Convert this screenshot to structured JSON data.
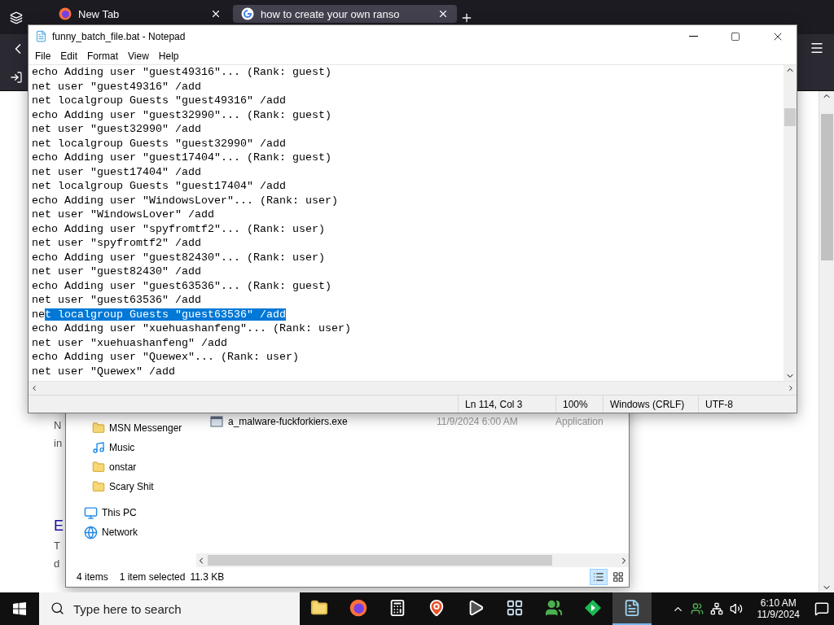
{
  "browser": {
    "tabs": [
      {
        "title": "New Tab",
        "selected": false
      },
      {
        "title": "how to create your own ranso",
        "selected": true
      }
    ],
    "page_fragments": [
      {
        "text": "N",
        "kind": "plain"
      },
      {
        "text": "in",
        "kind": "plain"
      },
      {
        "text": "E",
        "kind": "heading"
      },
      {
        "text": "T",
        "kind": "plain"
      },
      {
        "text": "d",
        "kind": "plain"
      }
    ]
  },
  "notepad": {
    "title": "funny_batch_file.bat - Notepad",
    "menu": [
      "File",
      "Edit",
      "Format",
      "View",
      "Help"
    ],
    "lines": [
      {
        "segments": [
          {
            "text": "echo Adding user \"guest49316\"... (Rank: guest)",
            "selected": false
          }
        ]
      },
      {
        "segments": [
          {
            "text": "net user \"guest49316\" /add",
            "selected": false
          }
        ]
      },
      {
        "segments": [
          {
            "text": "net localgroup Guests \"guest49316\" /add",
            "selected": false
          }
        ]
      },
      {
        "segments": [
          {
            "text": "echo Adding user \"guest32990\"... (Rank: guest)",
            "selected": false
          }
        ]
      },
      {
        "segments": [
          {
            "text": "net user \"guest32990\" /add",
            "selected": false
          }
        ]
      },
      {
        "segments": [
          {
            "text": "net localgroup Guests \"guest32990\" /add",
            "selected": false
          }
        ]
      },
      {
        "segments": [
          {
            "text": "echo Adding user \"guest17404\"... (Rank: guest)",
            "selected": false
          }
        ]
      },
      {
        "segments": [
          {
            "text": "net user \"guest17404\" /add",
            "selected": false
          }
        ]
      },
      {
        "segments": [
          {
            "text": "net localgroup Guests \"guest17404\" /add",
            "selected": false
          }
        ]
      },
      {
        "segments": [
          {
            "text": "echo Adding user \"WindowsLover\"... (Rank: user)",
            "selected": false
          }
        ]
      },
      {
        "segments": [
          {
            "text": "net user \"WindowsLover\" /add",
            "selected": false
          }
        ]
      },
      {
        "segments": [
          {
            "text": "echo Adding user \"spyfromtf2\"... (Rank: user)",
            "selected": false
          }
        ]
      },
      {
        "segments": [
          {
            "text": "net user \"spyfromtf2\" /add",
            "selected": false
          }
        ]
      },
      {
        "segments": [
          {
            "text": "echo Adding user \"guest82430\"... (Rank: user)",
            "selected": false
          }
        ]
      },
      {
        "segments": [
          {
            "text": "net user \"guest82430\" /add",
            "selected": false
          }
        ]
      },
      {
        "segments": [
          {
            "text": "echo Adding user \"guest63536\"... (Rank: guest)",
            "selected": false
          }
        ]
      },
      {
        "segments": [
          {
            "text": "net user \"guest63536\" /add",
            "selected": false
          }
        ]
      },
      {
        "segments": [
          {
            "text": "ne",
            "selected": false
          },
          {
            "text": "t localgroup Guests \"guest63536\" /add",
            "selected": true
          }
        ]
      },
      {
        "segments": [
          {
            "text": "echo Adding user \"xuehuashanfeng\"... (Rank: user)",
            "selected": false
          }
        ]
      },
      {
        "segments": [
          {
            "text": "net user \"xuehuashanfeng\" /add",
            "selected": false
          }
        ]
      },
      {
        "segments": [
          {
            "text": "echo Adding user \"Quewex\"... (Rank: user)",
            "selected": false
          }
        ]
      },
      {
        "segments": [
          {
            "text": "net user \"Quewex\" /add",
            "selected": false
          }
        ]
      }
    ],
    "status": [
      "Ln 114, Col 3",
      "100%",
      "Windows (CRLF)",
      "UTF-8"
    ]
  },
  "explorer": {
    "subfolders": [
      {
        "label": "MSN Messenger",
        "kind": "folder"
      },
      {
        "label": "Music",
        "kind": "music"
      },
      {
        "label": "onstar",
        "kind": "folder"
      },
      {
        "label": "Scary Shit",
        "kind": "folder"
      }
    ],
    "locations": [
      {
        "label": "This PC",
        "kind": "pc"
      },
      {
        "label": "Network",
        "kind": "network"
      }
    ],
    "files": [
      {
        "name": "a_malware-fuckforkiers.exe",
        "date": "11/9/2024 6:00 AM",
        "type": "Application"
      }
    ],
    "status": {
      "count": "4 items",
      "selection": "1 item selected",
      "size": "11.3 KB"
    },
    "views": [
      {
        "kind": "details",
        "selected": true
      },
      {
        "kind": "tiles",
        "selected": false
      }
    ]
  },
  "taskbar": {
    "search": {
      "placeholder": "Type here to search"
    },
    "apps": [
      {
        "kind": "explorer",
        "selected": false
      },
      {
        "kind": "firefox",
        "selected": false
      },
      {
        "kind": "calculator",
        "selected": false
      },
      {
        "kind": "maps",
        "selected": false
      },
      {
        "kind": "media",
        "selected": false
      },
      {
        "kind": "window",
        "selected": false
      },
      {
        "kind": "messenger",
        "selected": false
      },
      {
        "kind": "diamond",
        "selected": false
      },
      {
        "kind": "notepad",
        "selected": true
      }
    ],
    "time": "6:10 AM",
    "date": "11/9/2024"
  }
}
